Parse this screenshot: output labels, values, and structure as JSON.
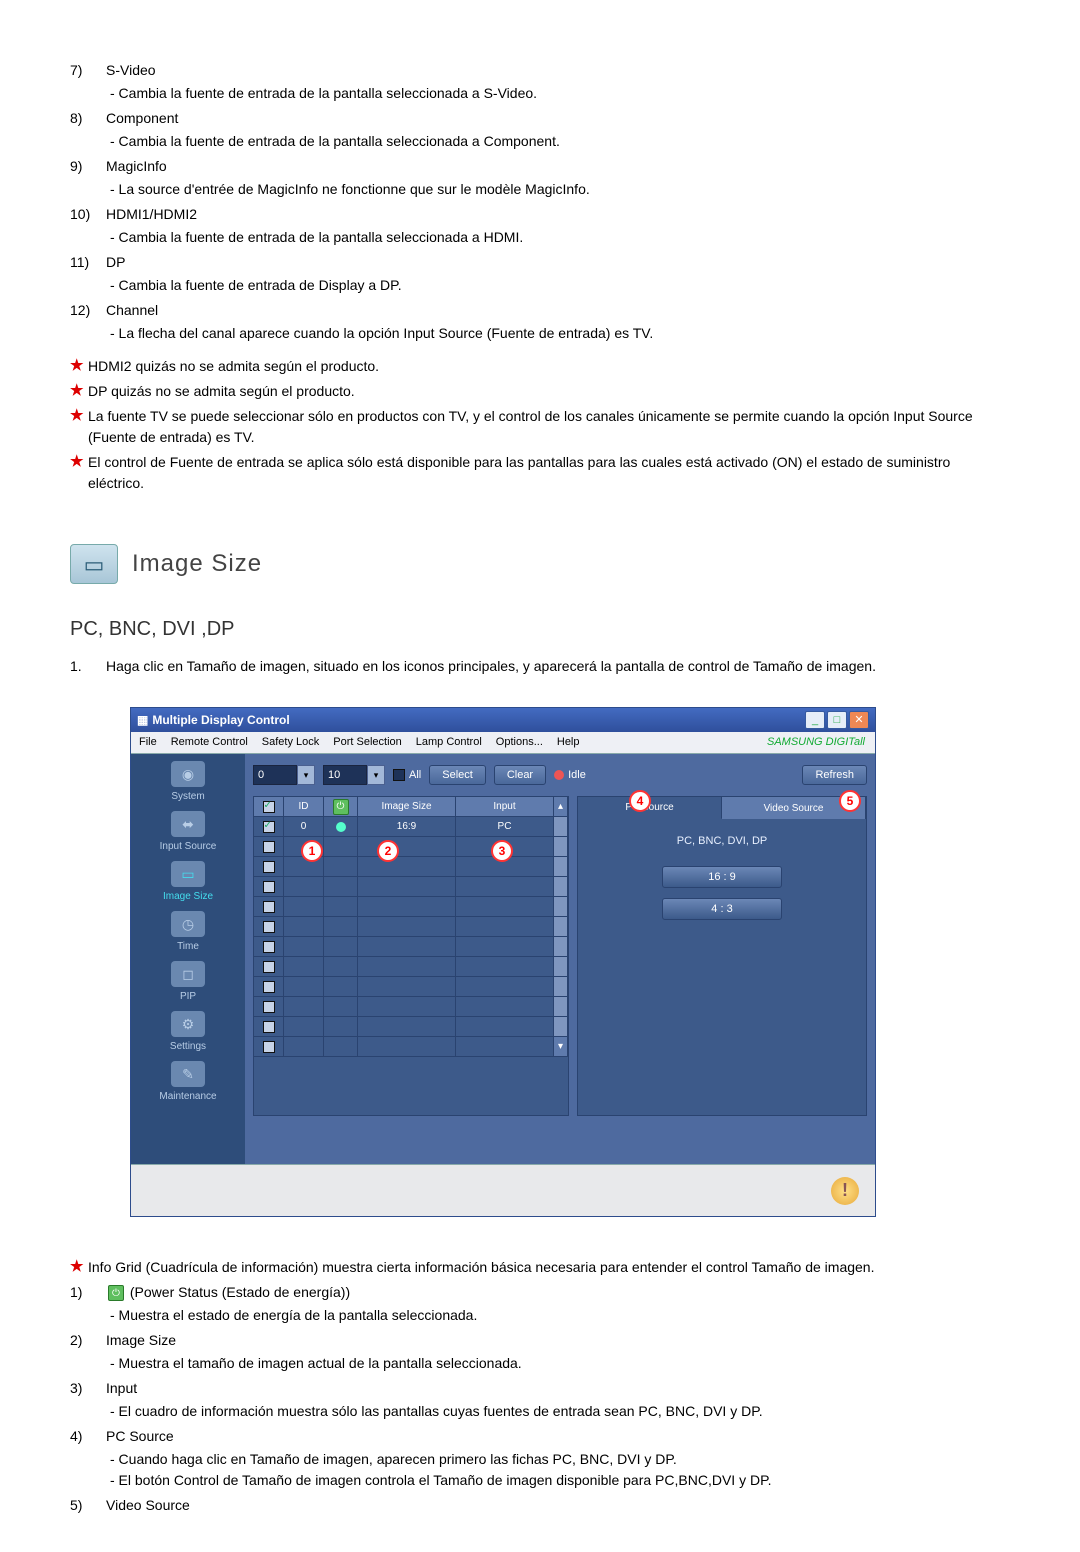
{
  "list_a": [
    {
      "num": "7)",
      "title": "S-Video",
      "desc": "- Cambia la fuente de entrada de la pantalla seleccionada a S-Video."
    },
    {
      "num": "8)",
      "title": "Component",
      "desc": "- Cambia la fuente de entrada de la pantalla seleccionada a Component."
    },
    {
      "num": "9)",
      "title": "MagicInfo",
      "desc": "- La source d'entrée de MagicInfo ne fonctionne que sur le modèle MagicInfo."
    },
    {
      "num": "10)",
      "title": "HDMI1/HDMI2",
      "desc": "- Cambia la fuente de entrada de la pantalla seleccionada a HDMI."
    },
    {
      "num": "11)",
      "title": "DP",
      "desc": "- Cambia la fuente de entrada de Display a DP."
    },
    {
      "num": "12)",
      "title": "Channel",
      "desc": "- La flecha del canal aparece cuando la opción Input Source (Fuente de entrada) es TV."
    }
  ],
  "notes": [
    "HDMI2 quizás no se admita según el producto.",
    "DP quizás no se admita según el producto.",
    "La fuente TV se puede seleccionar sólo en productos con TV, y el control de los canales únicamente se permite cuando la opción Input Source (Fuente de entrada) es TV.",
    "El control de Fuente de entrada se aplica sólo está disponible para las pantallas para las cuales está activado (ON) el estado de suministro eléctrico."
  ],
  "section_title": "Image Size",
  "subhead": "PC, BNC, DVI ,DP",
  "intro_num": "1.",
  "intro_text": "Haga clic en Tamaño de imagen, situado en los iconos principales, y aparecerá la pantalla de control de Tamaño de imagen.",
  "app": {
    "title": "Multiple Display Control",
    "menu": [
      "File",
      "Remote Control",
      "Safety Lock",
      "Port Selection",
      "Lamp Control",
      "Options...",
      "Help"
    ],
    "brand": "SAMSUNG DIGITall",
    "toolbar": {
      "v1": "0",
      "v2": "10",
      "all": "All",
      "select": "Select",
      "clear": "Clear",
      "idle": "Idle",
      "refresh": "Refresh"
    },
    "sidebar": [
      "System",
      "Input Source",
      "Image Size",
      "Time",
      "PIP",
      "Settings",
      "Maintenance"
    ],
    "thead": {
      "c1": "☑",
      "c2": "ID",
      "c3": "",
      "c4": "Image Size",
      "c5": "Input"
    },
    "row1": {
      "id": "0",
      "imgsize": "16:9",
      "input": "PC"
    },
    "tabs": {
      "pc": "PC Source",
      "video": "Video Source"
    },
    "tabhead": "PC, BNC, DVI, DP",
    "btn169": "16 : 9",
    "btn43": "4 : 3"
  },
  "note_info_grid": "Info Grid (Cuadrícula de información) muestra cierta información básica necesaria para entender el control Tamaño de imagen.",
  "list_b": [
    {
      "num": "1)",
      "title": "(Power Status (Estado de energía))",
      "desc": [
        "- Muestra el estado de energía de la pantalla seleccionada."
      ],
      "hasPowerIcon": true
    },
    {
      "num": "2)",
      "title": "Image Size",
      "desc": [
        "- Muestra el tamaño de imagen actual de la pantalla seleccionada."
      ]
    },
    {
      "num": "3)",
      "title": "Input",
      "desc": [
        "- El cuadro de información muestra sólo las pantallas cuyas fuentes de entrada sean PC, BNC, DVI y DP."
      ]
    },
    {
      "num": "4)",
      "title": "PC Source",
      "desc": [
        "- Cuando haga clic en Tamaño de imagen, aparecen primero las fichas PC, BNC, DVI y DP.",
        "- El botón Control de Tamaño de imagen controla el Tamaño de imagen disponible para PC,BNC,DVI y DP."
      ]
    },
    {
      "num": "5)",
      "title": "Video Source",
      "desc": []
    }
  ]
}
